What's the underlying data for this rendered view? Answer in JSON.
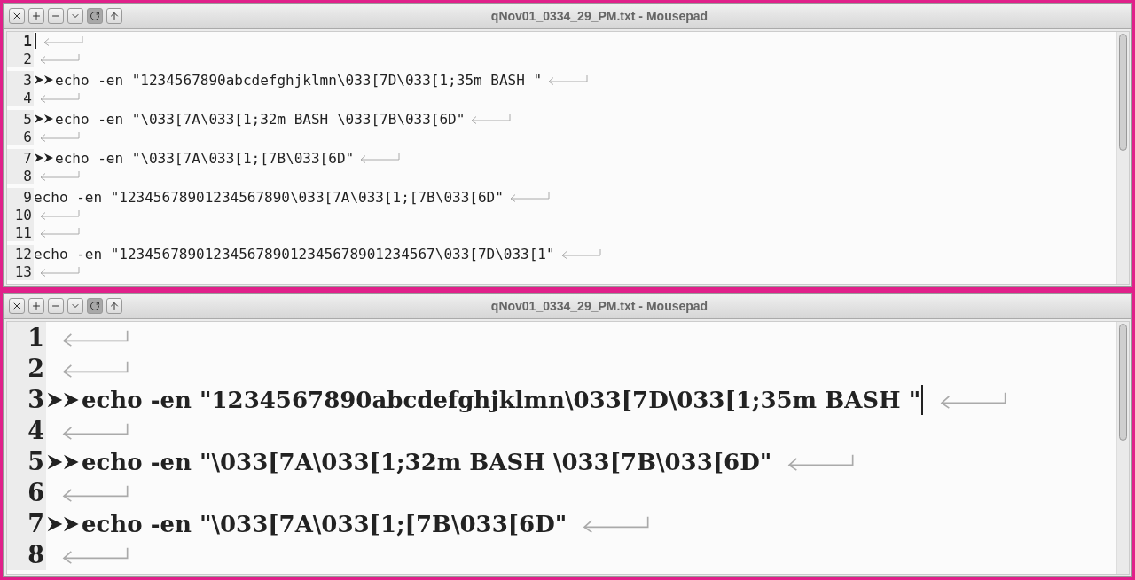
{
  "windows": [
    {
      "title": "qNov01_0334_29_PM.txt - Mousepad",
      "kind": "compact",
      "buttons": [
        {
          "kind": "close",
          "pressed": false
        },
        {
          "kind": "maximize",
          "pressed": false
        },
        {
          "kind": "minimize",
          "pressed": false
        },
        {
          "kind": "menu",
          "pressed": false
        },
        {
          "kind": "stick",
          "pressed": true
        },
        {
          "kind": "shade",
          "pressed": false
        }
      ],
      "lines": [
        {
          "number": "1",
          "indented": false,
          "current": true,
          "cursor": true
        },
        {
          "number": "2",
          "indented": false,
          "current": false
        },
        {
          "number": "3",
          "text": "echo -en \"1234567890abcdefghjklmn\\033[7D\\033[1;35m BASH \"",
          "indented": true,
          "current": false
        },
        {
          "number": "4",
          "indented": false,
          "current": false
        },
        {
          "number": "5",
          "text": "echo -en \"\\033[7A\\033[1;32m BASH \\033[7B\\033[6D\"",
          "indented": true,
          "current": false
        },
        {
          "number": "6",
          "indented": false,
          "current": false
        },
        {
          "number": "7",
          "text": "echo -en \"\\033[7A\\033[1;[7B\\033[6D\"",
          "indented": true,
          "current": false
        },
        {
          "number": "8",
          "indented": false,
          "current": false
        },
        {
          "number": "9",
          "text": "echo -en \"12345678901234567890\\033[7A\\033[1;[7B\\033[6D\"",
          "indented": false,
          "current": false
        },
        {
          "number": "10",
          "indented": false,
          "current": false
        },
        {
          "number": "11",
          "indented": false,
          "current": false
        },
        {
          "number": "12",
          "text": "echo -en \"1234567890123456789012345678901234567\\033[7D\\033[1\"",
          "indented": false,
          "current": false
        },
        {
          "number": "13",
          "indented": false,
          "current": false
        }
      ]
    },
    {
      "title": "qNov01_0334_29_PM.txt - Mousepad",
      "kind": "zoomed",
      "buttons": [
        {
          "kind": "close",
          "pressed": false
        },
        {
          "kind": "maximize",
          "pressed": false
        },
        {
          "kind": "minimize",
          "pressed": false
        },
        {
          "kind": "menu",
          "pressed": false
        },
        {
          "kind": "stick",
          "pressed": true
        },
        {
          "kind": "shade",
          "pressed": false
        }
      ],
      "lines": [
        {
          "number": "1",
          "indented": false
        },
        {
          "number": "2",
          "indented": false
        },
        {
          "number": "3",
          "text": "echo -en \"1234567890abcdefghjklmn\\033[7D\\033[1;35m BASH \"",
          "indented": true,
          "cursor": true
        },
        {
          "number": "4",
          "indented": false
        },
        {
          "number": "5",
          "text": "echo -en \"\\033[7A\\033[1;32m BASH \\033[7B\\033[6D\"",
          "indented": true
        },
        {
          "number": "6",
          "indented": false
        },
        {
          "number": "7",
          "text": "echo -en \"\\033[7A\\033[1;[7B\\033[6D\"",
          "indented": true
        },
        {
          "number": "8",
          "indented": false
        }
      ]
    }
  ]
}
